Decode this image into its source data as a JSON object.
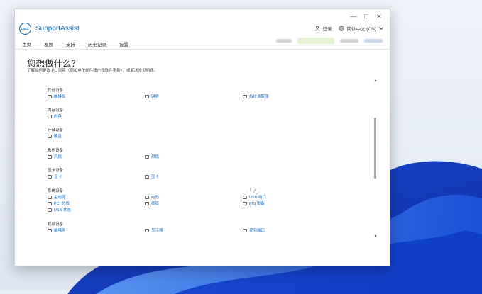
{
  "window": {
    "app_title": "SupportAssist",
    "caption": {
      "min": "—",
      "max": "□",
      "close": "✕"
    },
    "logo_text": "DELL"
  },
  "topbar": {
    "login": "登录",
    "language": "简体中文 (CN)"
  },
  "nav": {
    "tabs": [
      "主页",
      "发展",
      "支持",
      "历史记录",
      "设置"
    ]
  },
  "main": {
    "heading": "您想做什么？",
    "subheading": "了解如何更改 PC 设置（例如电子邮件账户和软件更新），或解决常见问题。"
  },
  "sections": [
    {
      "name": "其他设备",
      "links": [
        "触摸板",
        "键盘",
        "指纹读取器"
      ]
    },
    {
      "name": "内存设备",
      "links": [
        "内存"
      ]
    },
    {
      "name": "存储设备",
      "links": [
        "硬盘"
      ]
    },
    {
      "name": "散热设备",
      "links": [
        "风扇",
        "风扇"
      ]
    },
    {
      "name": "显卡设备",
      "links": [
        "显卡",
        "显卡"
      ]
    },
    {
      "name": "系统设备",
      "links": [
        "主电源",
        "电池",
        "USB 端口",
        "PCI 总线",
        "线缆",
        "PCI 设备",
        "USB 状态"
      ]
    },
    {
      "name": "视频设备",
      "links": [
        "触摸屏",
        "显示器",
        "视频端口"
      ]
    }
  ],
  "icons": [
    "person-icon",
    "globe-icon",
    "chevron-down-icon",
    "arrow-up-icon",
    "arrow-down-icon",
    "loading-spinner-icon"
  ],
  "colors": {
    "accent": "#1a73c9",
    "brand": "#0b6cb5"
  }
}
